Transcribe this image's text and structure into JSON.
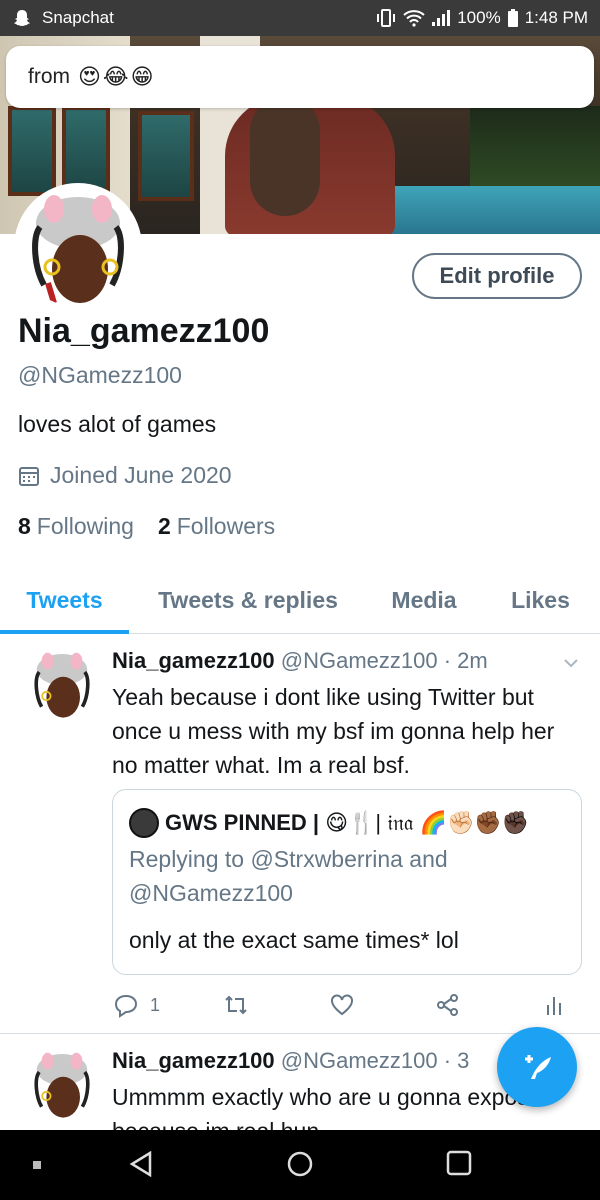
{
  "status_bar": {
    "app_name": "Snapchat",
    "battery": "100%",
    "time": "1:48 PM"
  },
  "notification": {
    "text": "from",
    "emojis": "😍😂😁"
  },
  "profile": {
    "edit_label": "Edit profile",
    "display_name": "Nia_gamezz100",
    "handle": "@NGamezz100",
    "bio": "loves alot of games",
    "joined": "Joined June 2020",
    "following_count": "8",
    "following_label": "Following",
    "followers_count": "2",
    "followers_label": "Followers"
  },
  "tabs": [
    {
      "label": "Tweets",
      "active": true
    },
    {
      "label": "Tweets & replies",
      "active": false
    },
    {
      "label": "Media",
      "active": false
    },
    {
      "label": "Likes",
      "active": false
    }
  ],
  "tweets": [
    {
      "name": "Nia_gamezz100",
      "meta": "@NGamezz100 · 2m",
      "text": "Yeah because i dont like using Twitter but once u mess with my bsf im gonna help her no matter what. Im a real bsf.",
      "quote": {
        "name": "GWS PINNED |",
        "name_suffix": "😋🍴| 𝔦𝔫𝔞 🌈✊🏻✊🏾✊🏿",
        "reply_line1": "Replying to @Strxwberrina and",
        "reply_line2": "@NGamezz100",
        "text": "only at the exact same times* lol"
      },
      "reply_count": "1"
    },
    {
      "name": "Nia_gamezz100",
      "meta": "@NGamezz100 · 3",
      "text": "Ummmm exactly who are u gonna expose because im real hun"
    }
  ],
  "colors": {
    "accent": "#1da1f2",
    "secondary_text": "#657786",
    "status_bar": "#3a3a3a"
  },
  "icons": [
    "snapchat-ghost-icon",
    "vibrate-icon",
    "wifi-icon",
    "signal-icon",
    "battery-icon",
    "calendar-icon",
    "chevron-down-icon",
    "reply-icon",
    "retweet-icon",
    "like-icon",
    "share-icon",
    "analytics-icon",
    "compose-icon",
    "back-icon",
    "home-icon",
    "recents-icon"
  ]
}
